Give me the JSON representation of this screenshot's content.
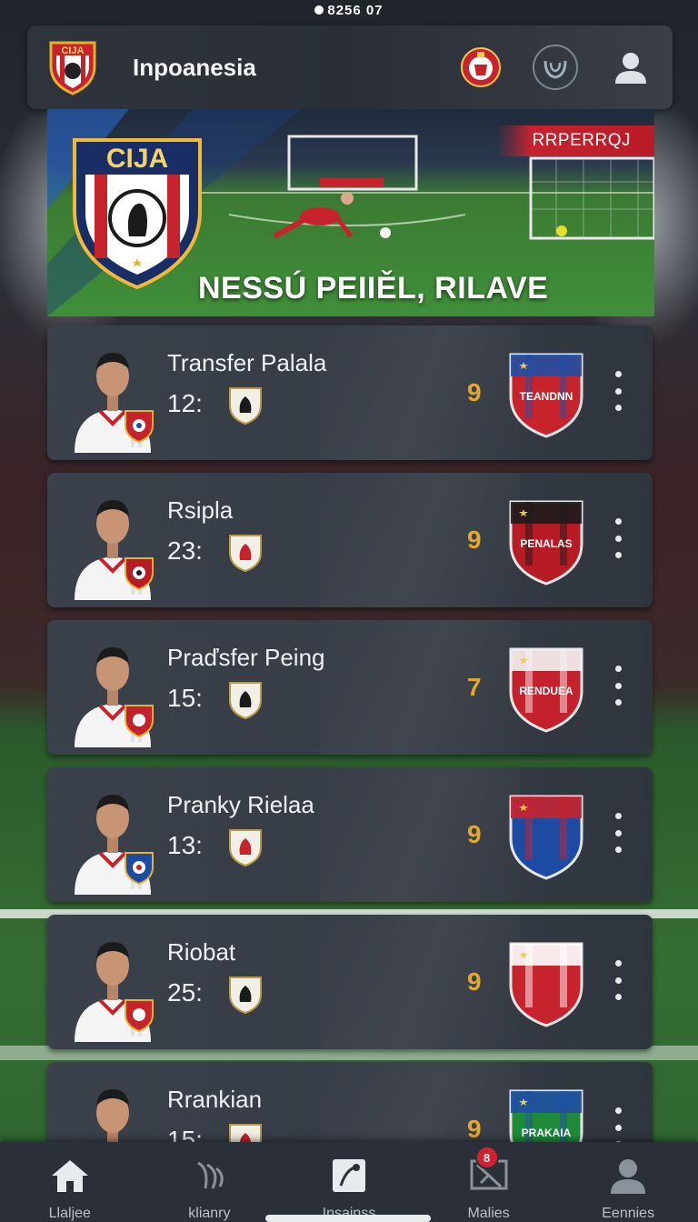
{
  "status_bar": {
    "time": "8256 07"
  },
  "header": {
    "title": "Inpoanesia",
    "crest_text": "CIJA"
  },
  "hero": {
    "crest_text": "CIJA",
    "tag": "RRPERRQJ",
    "headline": "NESSÚ PEIIĚL, RILAVE"
  },
  "players": [
    {
      "name": "Transfer Palala",
      "number": "12:",
      "rating": "9",
      "team_crest_text": "TEANDNN",
      "team_colors": [
        "#c7232d",
        "#1f4fa3"
      ]
    },
    {
      "name": "Rsipla",
      "number": "23:",
      "rating": "9",
      "team_crest_text": "PENALAS",
      "team_colors": [
        "#b71b24",
        "#1b1b1b"
      ]
    },
    {
      "name": "Praďsfer Peing",
      "number": "15:",
      "rating": "7",
      "team_crest_text": "RENDUEA",
      "team_colors": [
        "#c3212b",
        "#f3f3f3"
      ]
    },
    {
      "name": "Pranky Rielaa",
      "number": "13:",
      "rating": "9",
      "team_crest_text": "",
      "team_colors": [
        "#1d4aa2",
        "#c7232d"
      ]
    },
    {
      "name": "Riobat",
      "number": "25:",
      "rating": "9",
      "team_crest_text": "",
      "team_colors": [
        "#c7232d",
        "#ffffff"
      ]
    },
    {
      "name": "Rrankian",
      "number": "15:",
      "rating": "9",
      "team_crest_text": "PRAKAIA",
      "team_colors": [
        "#1f8a3a",
        "#1f4fa3"
      ]
    }
  ],
  "nav": [
    {
      "label": "Llaljee",
      "icon": "home-icon"
    },
    {
      "label": "klianry",
      "icon": "ball-icon"
    },
    {
      "label": "Insainss",
      "icon": "whistle-icon"
    },
    {
      "label": "Malies",
      "icon": "tactics-icon",
      "badge": "8"
    },
    {
      "label": "Eennies",
      "icon": "profile-icon"
    }
  ],
  "colors": {
    "accent": "#e0a92e",
    "brand_red": "#c7232d",
    "card_bg": "#3b414a"
  }
}
